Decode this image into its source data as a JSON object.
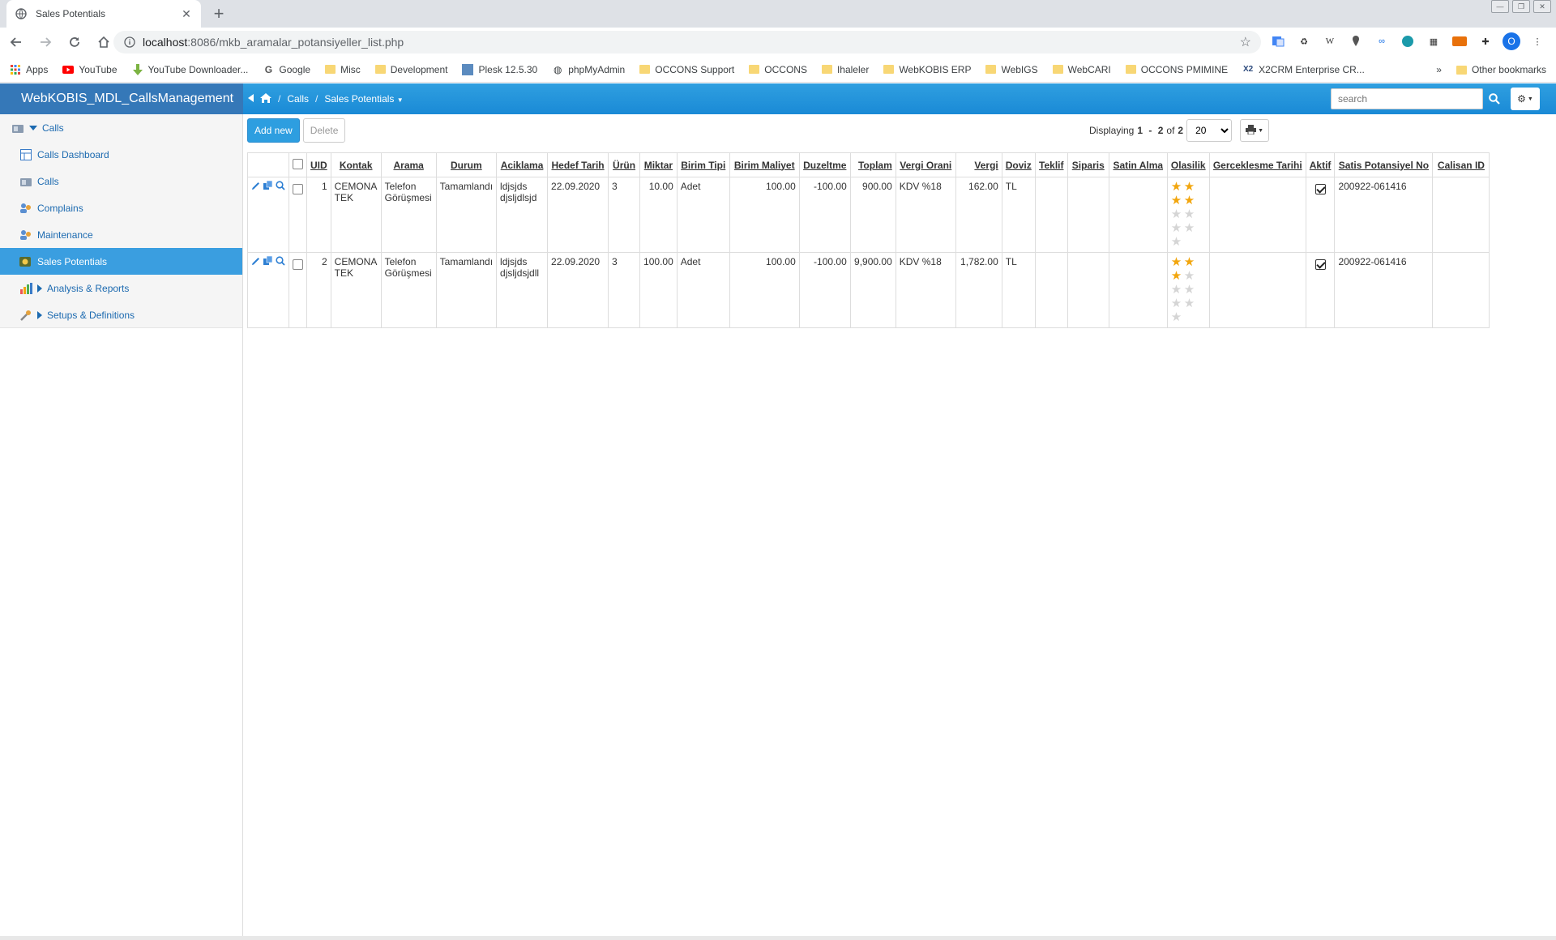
{
  "browser": {
    "tab_title": "Sales Potentials",
    "url_host": "localhost",
    "url_rest": ":8086/mkb_aramalar_potansiyeller_list.php",
    "profile_initial": "O",
    "bookmarks": [
      "Apps",
      "YouTube",
      "YouTube Downloader...",
      "Google",
      "Misc",
      "Development",
      "Plesk 12.5.30",
      "phpMyAdmin",
      "OCCONS Support",
      "OCCONS",
      "Ihaleler",
      "WebKOBIS ERP",
      "WebIGS",
      "WebCARI",
      "OCCONS PMIMINE",
      "X2CRM Enterprise CR..."
    ],
    "bookmarks_more": "»",
    "other_bookmarks": "Other bookmarks"
  },
  "app": {
    "brand": "WebKOBIS_MDL_CallsManagement",
    "breadcrumb": [
      "Calls",
      "Sales Potentials"
    ],
    "search_placeholder": "search"
  },
  "sidebar": {
    "items": [
      {
        "label": "Calls"
      },
      {
        "label": "Calls Dashboard"
      },
      {
        "label": "Calls"
      },
      {
        "label": "Complains"
      },
      {
        "label": "Maintenance"
      },
      {
        "label": "Sales Potentials"
      },
      {
        "label": "Analysis & Reports"
      },
      {
        "label": "Setups & Definitions"
      }
    ]
  },
  "actions": {
    "add_new": "Add new",
    "delete": "Delete"
  },
  "paging": {
    "displaying": "Displaying",
    "from": "1",
    "dash": " - ",
    "to": "2",
    "of": "of",
    "total": "2",
    "page_size": "20"
  },
  "table": {
    "headers": [
      "UID",
      "Kontak",
      "Arama",
      "Durum",
      "Aciklama",
      "Hedef Tarih",
      "Ürün",
      "Miktar",
      "Birim Tipi",
      "Birim Maliyet",
      "Duzeltme",
      "Toplam",
      "Vergi Orani",
      "Vergi",
      "Doviz",
      "Teklif",
      "Siparis",
      "Satin Alma",
      "Olasilik",
      "Gerceklesme Tarihi",
      "Aktif",
      "Satis Potansiyel No",
      "Calisan ID"
    ],
    "rows": [
      {
        "uid": "1",
        "kontak": "CEMONA TEK",
        "arama": "Telefon Görüşmesi",
        "durum": "Tamamlandı",
        "aciklama": "ldjsjds djsljdlsjd",
        "hedef_tarih": "22.09.2020",
        "urun": "3",
        "miktar": "10.00",
        "birim_tipi": "Adet",
        "birim_maliyet": "100.00",
        "duzeltme": "-100.00",
        "toplam": "900.00",
        "vergi_orani": "KDV %18",
        "vergi": "162.00",
        "doviz": "TL",
        "teklif": "",
        "siparis": "",
        "satin_alma": "",
        "olasilik": 4,
        "gerceklesme_tarihi": "",
        "aktif": true,
        "satis_potansiyel_no": "200922-061416",
        "calisan_id": ""
      },
      {
        "uid": "2",
        "kontak": "CEMONA TEK",
        "arama": "Telefon Görüşmesi",
        "durum": "Tamamlandı",
        "aciklama": "ldjsjds djsljdsjdll",
        "hedef_tarih": "22.09.2020",
        "urun": "3",
        "miktar": "100.00",
        "birim_tipi": "Adet",
        "birim_maliyet": "100.00",
        "duzeltme": "-100.00",
        "toplam": "9,900.00",
        "vergi_orani": "KDV %18",
        "vergi": "1,782.00",
        "doviz": "TL",
        "teklif": "",
        "siparis": "",
        "satin_alma": "",
        "olasilik": 3,
        "gerceklesme_tarihi": "",
        "aktif": true,
        "satis_potansiyel_no": "200922-061416",
        "calisan_id": ""
      }
    ],
    "star_total": 9
  },
  "colors": {
    "header_blue": "#2f9fe0",
    "brand_blue": "#3578b8",
    "active_item": "#3a9ee0",
    "star_on": "#f2a60e"
  }
}
